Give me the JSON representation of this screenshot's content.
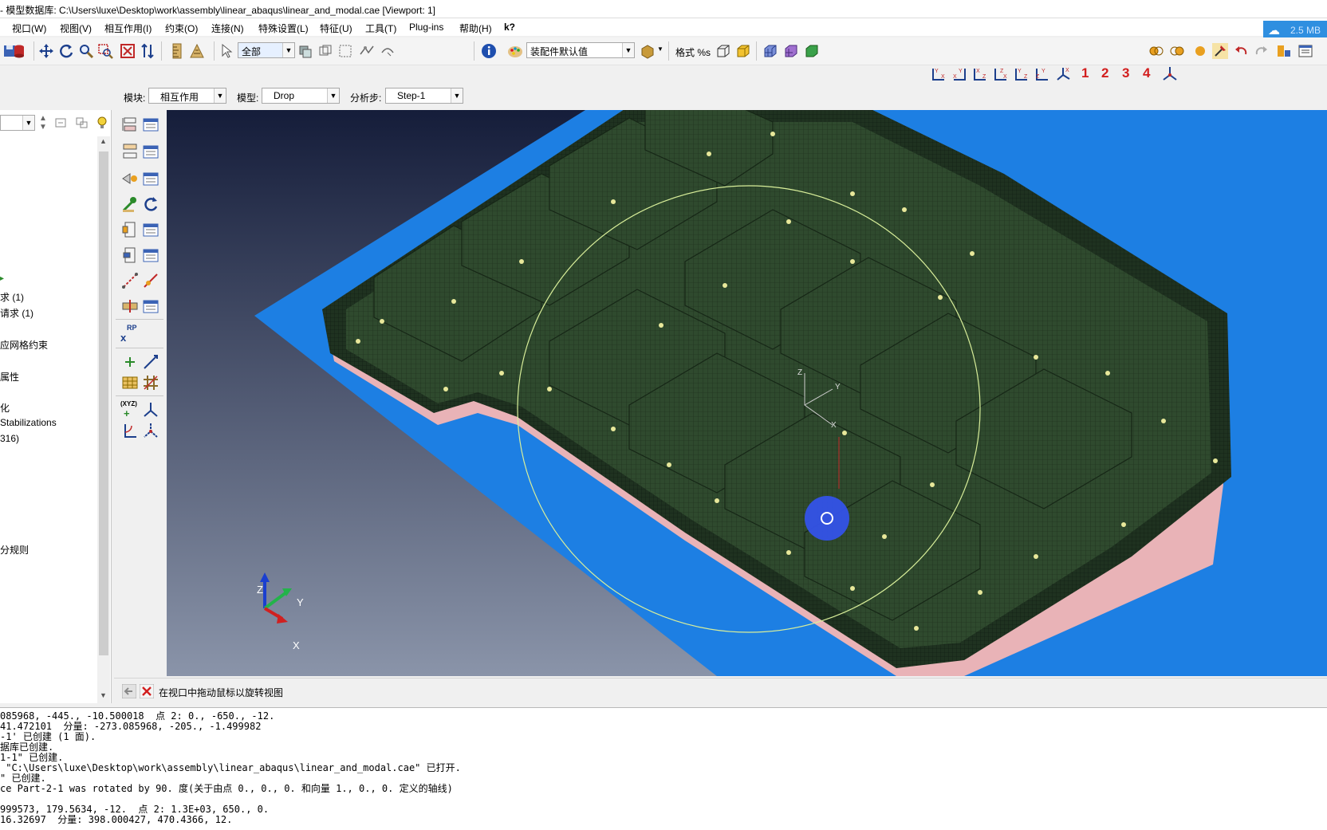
{
  "window": {
    "title": "- 模型数据库: C:\\Users\\luxe\\Desktop\\work\\assembly\\linear_abaqus\\linear_and_modal.cae [Viewport: 1]"
  },
  "menu": {
    "items": [
      "视口(W)",
      "视图(V)",
      "相互作用(I)",
      "约束(O)",
      "连接(N)",
      "特殊设置(L)",
      "特征(U)",
      "工具(T)",
      "Plug-ins",
      "帮助(H)",
      "k?"
    ]
  },
  "cloud_badge": {
    "text": "2.5 MB"
  },
  "toolbar": {
    "selection_filter": "全部",
    "render_style_select": "装配件默认值",
    "format_label": "格式 %s",
    "view_numbers": [
      "1",
      "2",
      "3",
      "4"
    ]
  },
  "context": {
    "module_label": "模块:",
    "module_value": "相互作用",
    "model_label": "模型:",
    "model_value": "Drop",
    "step_label": "分析步:",
    "step_value": "Step-1"
  },
  "tree": {
    "items": [
      "求 (1)",
      "请求 (1)",
      "应网格约束",
      "属性",
      "化",
      "Stabilizations",
      "316)",
      "分规则"
    ]
  },
  "toolbox": {
    "rp_label": "RP",
    "csys_label": "(XYZ)"
  },
  "viewport": {
    "triad_labels": {
      "z": "Z",
      "y": "Y",
      "x": "X"
    },
    "csys_labels": {
      "z": "Z",
      "y": "Y",
      "x": "X"
    }
  },
  "prompt": {
    "text": "在视口中拖动鼠标以旋转视图"
  },
  "messages": [
    "085968, -445., -10.500018  点 2: 0., -650., -12.",
    "41.472101  分量: -273.085968, -205., -1.499982",
    "-1' 已创建 (1 面).",
    "据库已创建.",
    "1-1\" 已创建.",
    " \"C:\\Users\\luxe\\Desktop\\work\\assembly\\linear_abaqus\\linear_and_modal.cae\" 已打开.",
    "\" 已创建.",
    "ce Part-2-1 was rotated by 90. 度(关于由点 0., 0., 0. 和向量 1., 0., 0. 定义的轴线)",
    "",
    "999573, 179.5634, -12.  点 2: 1.3E+03, 650., 0.",
    "16.32697  分量: 398.000427, 470.4366, 12."
  ],
  "colors": {
    "viewport_gradient_top": "#151d3a",
    "viewport_gradient_bottom": "#8a94a9",
    "plane_blue": "#1d7fe3",
    "mesh_green": "#2f4a2e",
    "flange_pink": "#e9b3b7",
    "rotate_circle": "#d9ef9a",
    "number_red": "#d21e1e"
  }
}
